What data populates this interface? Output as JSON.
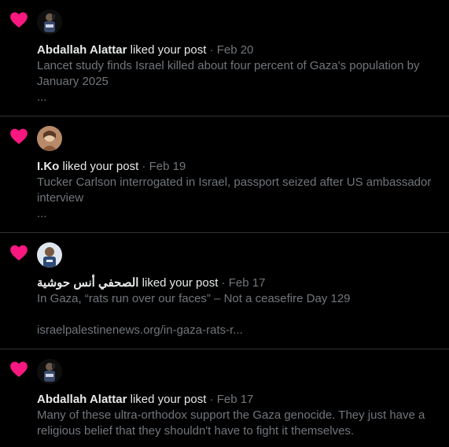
{
  "notifications": [
    {
      "name": "Abdallah Alattar",
      "action": "liked your post",
      "date": "· Feb 20",
      "text": "Lancet study finds Israel killed about four percent of Gaza's population by January 2025",
      "extra": "...",
      "avatar": "avatar-abdallah"
    },
    {
      "name": "I.Ko",
      "action": "liked your post",
      "date": "· Feb 19",
      "text": "Tucker Carlson interrogated in Israel, passport seized after US ambassador interview",
      "extra": "...",
      "avatar": "avatar-iko"
    },
    {
      "name": "الصحفي أنس حوشية",
      "action": "liked your post",
      "date": "· Feb 17",
      "text": "In Gaza, “rats run over our faces” – Not a ceasefire Day 129",
      "extra": "israelpalestinenews.org/in-gaza-rats-r...",
      "avatar": "avatar-anas"
    },
    {
      "name": "Abdallah Alattar",
      "action": "liked your post",
      "date": "· Feb 17",
      "text": "Many of these ultra-orthodox support the Gaza genocide. They just have a religious belief that they shouldn't have to fight it themselves.",
      "extra": "",
      "avatar": "avatar-abdallah"
    }
  ],
  "colors": {
    "heart": "#f91880",
    "muted": "#71767b",
    "text": "#e7e9ea",
    "divider": "#2f3336"
  },
  "icons": {
    "like": "heart-icon"
  }
}
